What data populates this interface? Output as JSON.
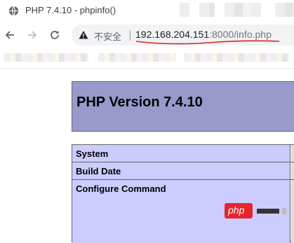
{
  "tab": {
    "title": "PHP 7.4.10 - phpinfo()",
    "favicon": "globe-icon"
  },
  "toolbar": {
    "back_icon": "arrow-left-icon",
    "forward_icon": "arrow-right-icon",
    "reload_icon": "reload-icon",
    "security_icon": "warning-triangle-icon",
    "security_label": "不安全",
    "url_host": "192.168.204.151",
    "url_rest": ":8000/info.php"
  },
  "phpinfo": {
    "title": "PHP Version 7.4.10",
    "rows": [
      "System",
      "Build Date",
      "Configure Command"
    ]
  },
  "watermark": {
    "logo_text": "php"
  },
  "colors": {
    "header_bg": "#9999cc",
    "label_bg": "#ccccff",
    "value_bg": "#dddddd",
    "underline": "#e02020",
    "watermark_red": "#e4262d"
  }
}
